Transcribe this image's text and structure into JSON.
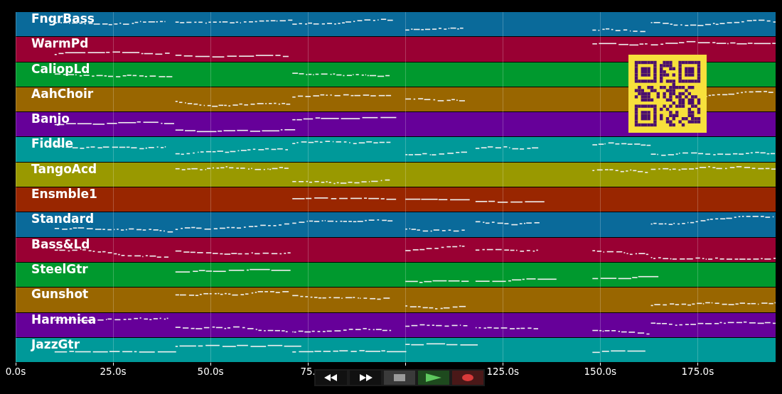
{
  "tracks": [
    {
      "name": "FngrBass",
      "color": "#0a6a9a"
    },
    {
      "name": "WarmPd",
      "color": "#990033"
    },
    {
      "name": "CaliopLd",
      "color": "#00992e"
    },
    {
      "name": "AahChoir",
      "color": "#996600"
    },
    {
      "name": "Banjo",
      "color": "#660099"
    },
    {
      "name": "Fiddle",
      "color": "#009999"
    },
    {
      "name": "TangoAcd",
      "color": "#999900"
    },
    {
      "name": "Ensmble1",
      "color": "#992600"
    },
    {
      "name": "Standard",
      "color": "#0a6a9a"
    },
    {
      "name": "Bass&Ld",
      "color": "#990033"
    },
    {
      "name": "SteelGtr",
      "color": "#00992e"
    },
    {
      "name": "Gunshot",
      "color": "#996600"
    },
    {
      "name": "Harmnica",
      "color": "#660099"
    },
    {
      "name": "JazzGtr",
      "color": "#009999"
    }
  ],
  "axis": {
    "ticks_before": [
      "0.0s",
      "25.0s",
      "50.0s",
      "75."
    ],
    "ticks_after": [
      "125.0s",
      "150.0s",
      "175.0s"
    ]
  },
  "transport": [
    {
      "kind": "rewind"
    },
    {
      "kind": "forward"
    },
    {
      "kind": "stop"
    },
    {
      "kind": "play"
    },
    {
      "kind": "record"
    }
  ]
}
